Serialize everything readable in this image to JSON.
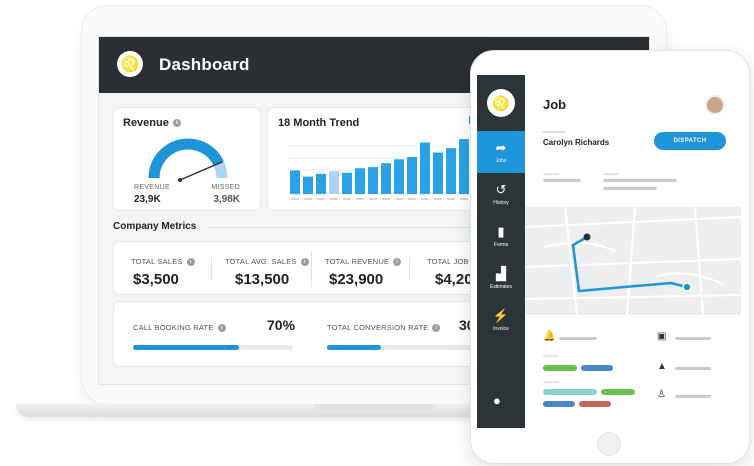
{
  "dashboard": {
    "title": "Dashboard",
    "revenue_card": {
      "title": "Revenue",
      "revenue_label": "REVENUE",
      "revenue_value": "23,9K",
      "missed_label": "MISSED",
      "missed_value": "3,98K",
      "gauge_fraction": 0.86
    },
    "trend_card": {
      "title": "18 Month Trend",
      "bars": [
        0.42,
        0.31,
        0.36,
        0.41,
        0.38,
        0.46,
        0.48,
        0.55,
        0.62,
        0.66,
        0.92,
        0.74,
        0.82,
        0.98,
        0.62
      ]
    },
    "section_title": "Company Metrics",
    "metrics": [
      {
        "label": "TOTAL SALES",
        "value": "$3,500"
      },
      {
        "label": "TOTAL AVG. SALES",
        "value": "$13,500"
      },
      {
        "label": "TOTAL REVENUE",
        "value": "$23,900"
      },
      {
        "label": "TOTAL JOB AV",
        "value": "$4,20"
      }
    ],
    "rates": [
      {
        "label": "CALL BOOKING RATE",
        "value": "70%",
        "fraction": 0.66
      },
      {
        "label": "TOTAL CONVERSION RATE",
        "value": "30",
        "fraction": 0.34
      }
    ]
  },
  "tablet": {
    "nav": [
      {
        "label": "Jobs",
        "icon": "jobs-icon"
      },
      {
        "label": "History",
        "icon": "history-icon"
      },
      {
        "label": "Forms",
        "icon": "forms-icon"
      },
      {
        "label": "Estimates",
        "icon": "estimates-icon"
      },
      {
        "label": "Invoice",
        "icon": "invoice-icon"
      }
    ],
    "job_title": "Job",
    "customer": "Carolyn Richards",
    "dispatch_label": "DISPATCH"
  },
  "colors": {
    "accent": "#1e95d9",
    "accent_light": "#a9d4f3",
    "dark": "#2b2e33",
    "green": "#6cc04a",
    "red": "#c0685a",
    "blue_pill": "#4a86c8"
  }
}
